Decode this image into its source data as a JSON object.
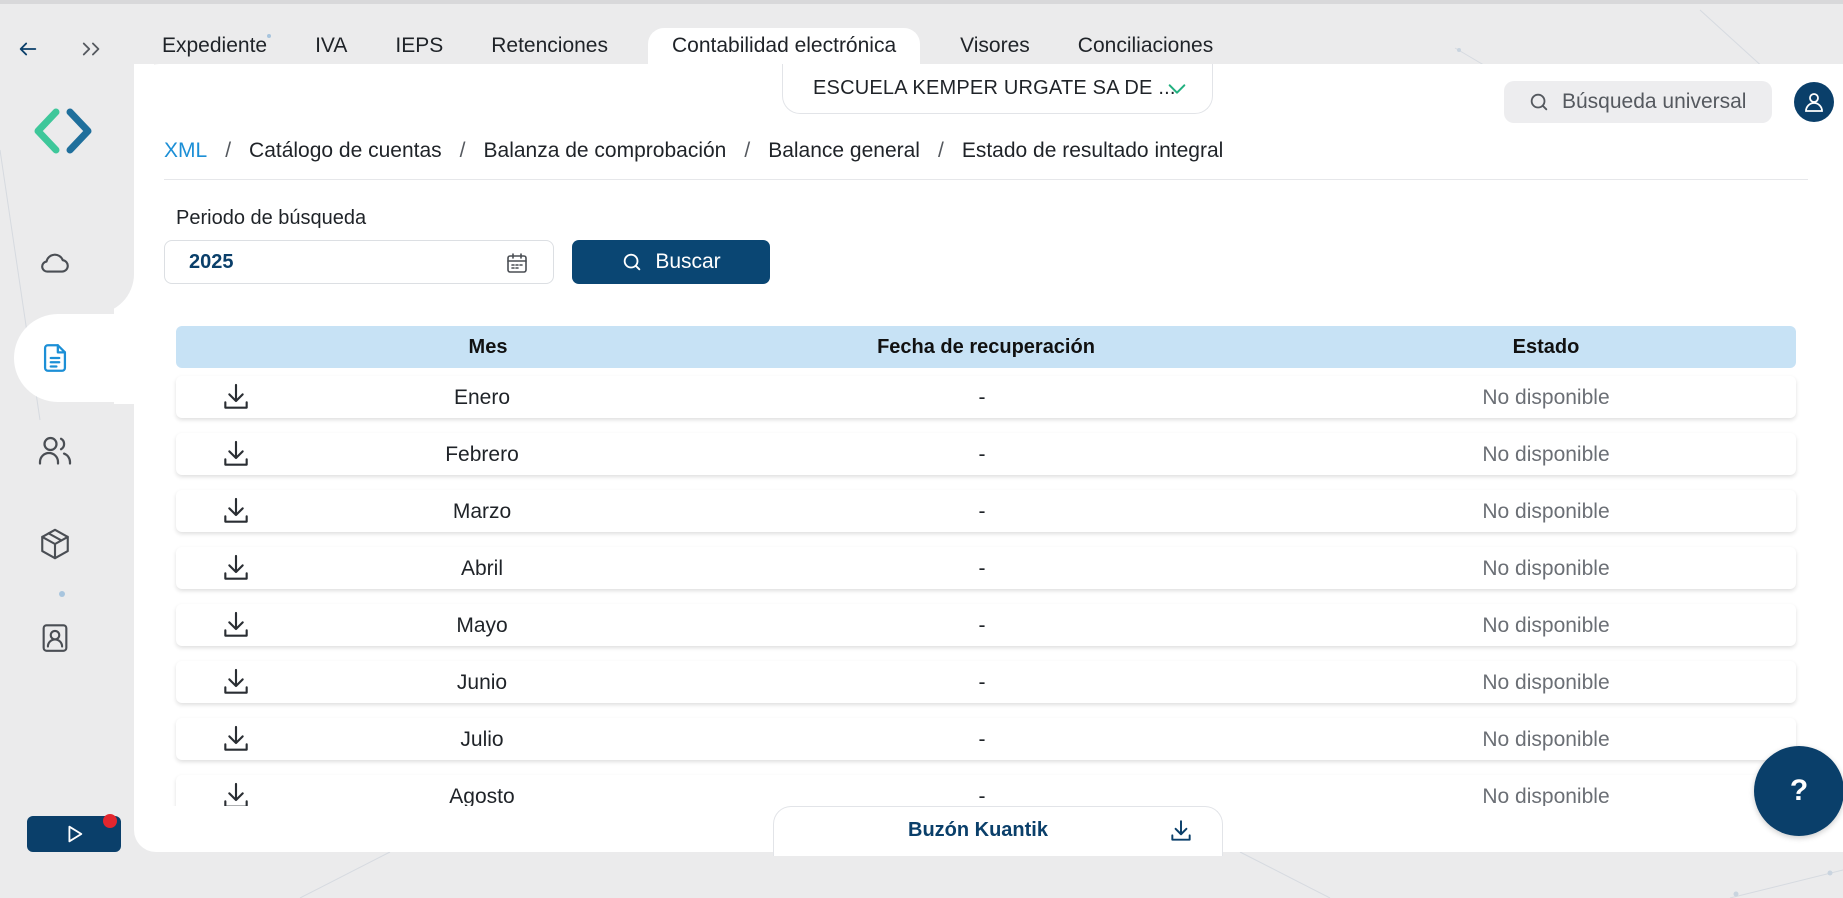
{
  "nav": {
    "back_icon": "arrow-left-icon",
    "forward_icon": "double-chevron-right-icon"
  },
  "tabs": [
    {
      "label": "Expediente"
    },
    {
      "label": "IVA"
    },
    {
      "label": "IEPS"
    },
    {
      "label": "Retenciones"
    },
    {
      "label": "Contabilidad electrónica",
      "active": true
    },
    {
      "label": "Visores"
    },
    {
      "label": "Conciliaciones"
    }
  ],
  "sidebar": {
    "items": [
      {
        "icon": "cloud-icon"
      },
      {
        "icon": "document-icon",
        "active": true
      },
      {
        "icon": "users-icon"
      },
      {
        "icon": "box-icon"
      },
      {
        "icon": "contact-card-icon"
      }
    ],
    "play_icon": "play-icon"
  },
  "header": {
    "company": "ESCUELA KEMPER URGATE SA DE ...",
    "search_placeholder": "Búsqueda universal"
  },
  "breadcrumb": [
    "XML",
    "Catálogo de cuentas",
    "Balanza de comprobación",
    "Balance general",
    "Estado de resultado integral"
  ],
  "breadcrumb_separator": "/",
  "filter": {
    "label": "Periodo de búsqueda",
    "value": "2025",
    "button": "Buscar"
  },
  "table": {
    "headers": {
      "mes": "Mes",
      "fecha": "Fecha de recuperación",
      "estado": "Estado"
    },
    "rows": [
      {
        "mes": "Enero",
        "fecha": "-",
        "estado": "No disponible"
      },
      {
        "mes": "Febrero",
        "fecha": "-",
        "estado": "No disponible"
      },
      {
        "mes": "Marzo",
        "fecha": "-",
        "estado": "No disponible"
      },
      {
        "mes": "Abril",
        "fecha": "-",
        "estado": "No disponible"
      },
      {
        "mes": "Mayo",
        "fecha": "-",
        "estado": "No disponible"
      },
      {
        "mes": "Junio",
        "fecha": "-",
        "estado": "No disponible"
      },
      {
        "mes": "Julio",
        "fecha": "-",
        "estado": "No disponible"
      },
      {
        "mes": "Agosto",
        "fecha": "-",
        "estado": "No disponible"
      }
    ]
  },
  "buzon": {
    "label": "Buzón Kuantik"
  },
  "help": {
    "label": "?"
  },
  "colors": {
    "primary": "#0a3f6a",
    "accent_link": "#1c8fd6",
    "table_header": "#c7e2f5",
    "notification": "#e3262e",
    "logo_green": "#3ec79a",
    "logo_blue": "#1f6f9c"
  }
}
